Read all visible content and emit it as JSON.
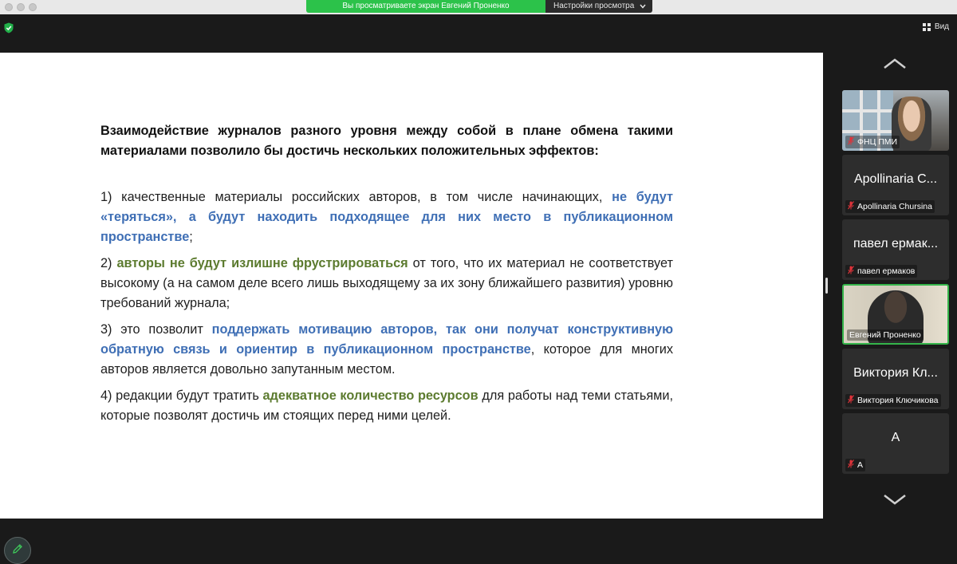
{
  "banner": {
    "sharing_text": "Вы просматриваете экран Евгений Проненко",
    "view_settings_label": "Настройки просмотра"
  },
  "toolbar": {
    "view_label": "Вид"
  },
  "document": {
    "heading": "Взаимодействие журналов разного уровня между собой в плане обмена такими материалами позволило бы достичь нескольких положительных эффектов:",
    "p1": {
      "a": "1) качественные материалы российских авторов, в том числе начинающих, ",
      "b": "не будут «теряться», а будут находить подходящее для них место в публикационном пространстве",
      "c": ";"
    },
    "p2": {
      "a": "2) ",
      "b": "авторы не будут излишне фрустрироваться",
      "c": " от того, что их материал не соответствует высокому (а на самом деле всего лишь выходящему за их зону ближайшего развития) уровню требований журнала;"
    },
    "p3": {
      "a": "3) это позволит ",
      "b": "поддержать мотивацию авторов, так они получат конструктивную обратную связь и ориентир в публикационном пространстве",
      "c": ", которое для многих авторов является довольно запутанным местом."
    },
    "p4": {
      "a": "4) редакции будут тратить ",
      "b": "адекватное количество ресурсов",
      "c": " для работы над теми статьями, которые позволят достичь им стоящих перед ними целей."
    }
  },
  "participants": [
    {
      "display_name": "",
      "label": "ФНЦ ПМИ",
      "muted": true,
      "video": true
    },
    {
      "display_name": "Apollinaria C...",
      "label": "Apollinaria Chursina",
      "muted": true,
      "video": false
    },
    {
      "display_name": "павел ермак...",
      "label": "павел ермаков",
      "muted": true,
      "video": false
    },
    {
      "display_name": "",
      "label": "Евгений Проненко",
      "muted": false,
      "video": true,
      "active_speaker": true
    },
    {
      "display_name": "Виктория Кл...",
      "label": "Виктория Ключикова",
      "muted": true,
      "video": false
    },
    {
      "display_name": "А",
      "label": "А",
      "muted": true,
      "video": false
    }
  ],
  "colors": {
    "share_banner": "#2cc24a",
    "highlight_blue": "#3f6fb5",
    "highlight_green": "#5c7b2f",
    "active_speaker_border": "#34b44a",
    "mic_muted": "#e0333a"
  },
  "icons": [
    "shield-check-icon",
    "grid-view-icon",
    "chevron-down-icon",
    "chevron-up-icon",
    "mic-muted-icon",
    "pencil-icon"
  ]
}
